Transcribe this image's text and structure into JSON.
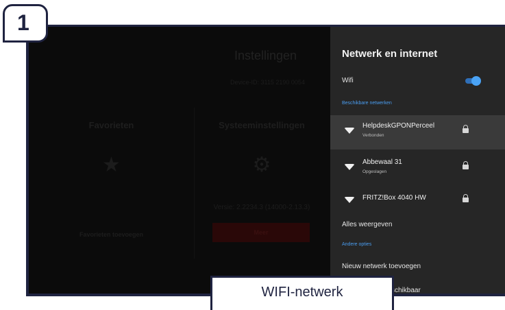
{
  "step": {
    "number": "1"
  },
  "background": {
    "title": "Instellingen",
    "device_id": "Device-ID: 3115 2190 0054",
    "favorites": {
      "title": "Favorieten",
      "icon": "star-icon",
      "add_label": "Favorieten toevoegen"
    },
    "system": {
      "title": "Systeeminstellingen",
      "icon": "gear-icon",
      "version": "Versie: 2.2234.3 (14000-2.13.3)",
      "more_label": "Meer"
    }
  },
  "panel": {
    "title": "Netwerk en internet",
    "wifi_label": "Wifi",
    "wifi_enabled": true,
    "available_section": "Beschikbare netwerken",
    "networks": [
      {
        "name": "HelpdeskGPONPerceel",
        "status": "Verbonden",
        "secured": true,
        "selected": true
      },
      {
        "name": "Abbewaal 31",
        "status": "Opgeslagen",
        "secured": true,
        "selected": false
      },
      {
        "name": "FRITZ!Box 4040 HW",
        "status": "",
        "secured": true,
        "selected": false
      }
    ],
    "show_all": "Alles weergeven",
    "other_section": "Andere opties",
    "add_network": "Nieuw netwerk toevoegen",
    "last_item_partial": "schikbaar"
  },
  "caption": {
    "text": "WIFI-netwerk"
  },
  "colors": {
    "accent": "#4a9df0",
    "frame": "#1f2340",
    "panel": "#262626"
  }
}
